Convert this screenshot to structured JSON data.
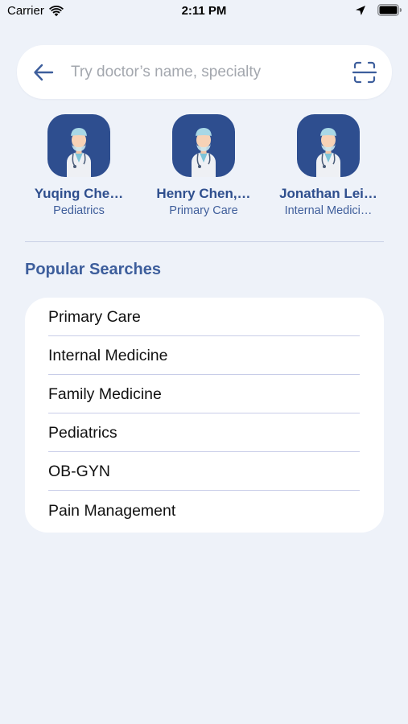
{
  "status_bar": {
    "carrier": "Carrier",
    "time": "2:11 PM"
  },
  "search": {
    "placeholder": "Try doctor’s name, specialty",
    "value": ""
  },
  "doctors": [
    {
      "name": "Yuqing Che…",
      "specialty": "Pediatrics"
    },
    {
      "name": "Henry Chen,…",
      "specialty": "Primary Care"
    },
    {
      "name": "Jonathan Lei…",
      "specialty": "Internal Medici…"
    }
  ],
  "popular": {
    "title": "Popular Searches",
    "items": [
      "Primary Care",
      "Internal Medicine",
      "Family Medicine",
      "Pediatrics",
      "OB-GYN",
      "Pain Management"
    ]
  },
  "colors": {
    "background": "#eef2f9",
    "accent": "#3d5e9c",
    "avatar_bg": "#2e4e8f"
  },
  "icons": [
    "wifi-icon",
    "location-arrow-icon",
    "battery-icon",
    "back-arrow-icon",
    "scan-icon",
    "doctor-avatar-icon"
  ]
}
